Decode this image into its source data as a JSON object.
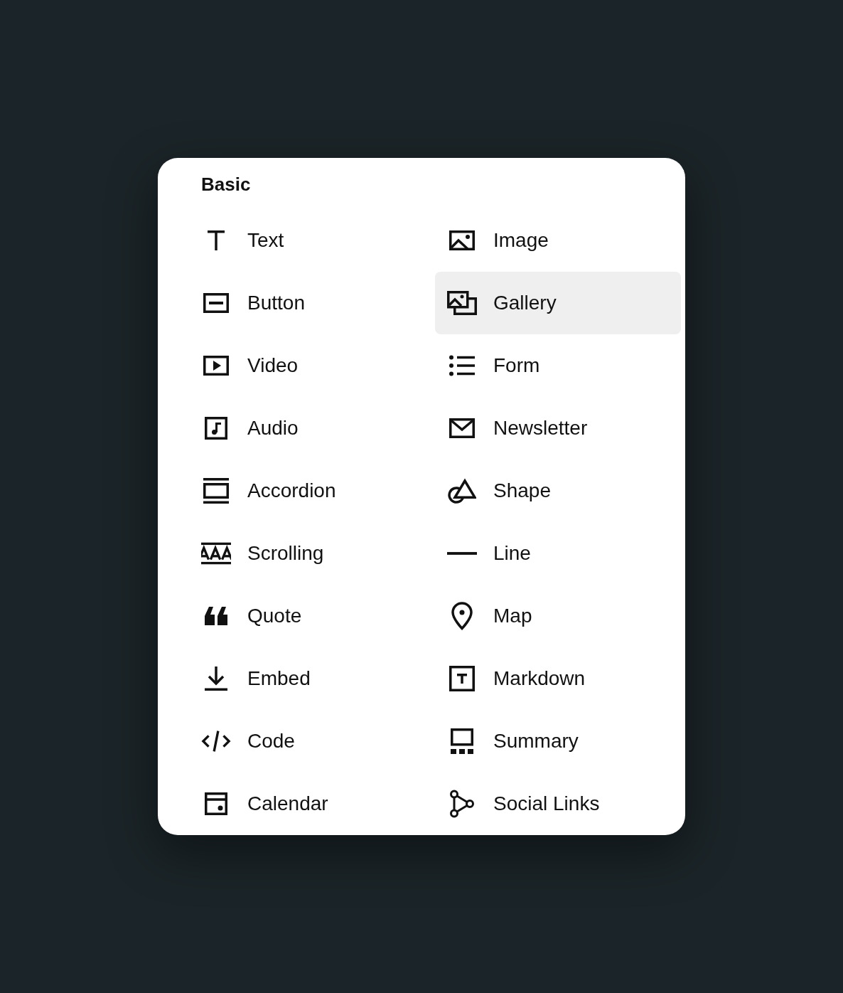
{
  "panel": {
    "heading": "Basic",
    "items": [
      {
        "label": "Text",
        "selected": false
      },
      {
        "label": "Image",
        "selected": false
      },
      {
        "label": "Button",
        "selected": false
      },
      {
        "label": "Gallery",
        "selected": true
      },
      {
        "label": "Video",
        "selected": false
      },
      {
        "label": "Form",
        "selected": false
      },
      {
        "label": "Audio",
        "selected": false
      },
      {
        "label": "Newsletter",
        "selected": false
      },
      {
        "label": "Accordion",
        "selected": false
      },
      {
        "label": "Shape",
        "selected": false
      },
      {
        "label": "Scrolling",
        "selected": false
      },
      {
        "label": "Line",
        "selected": false
      },
      {
        "label": "Quote",
        "selected": false
      },
      {
        "label": "Map",
        "selected": false
      },
      {
        "label": "Embed",
        "selected": false
      },
      {
        "label": "Markdown",
        "selected": false
      },
      {
        "label": "Code",
        "selected": false
      },
      {
        "label": "Summary",
        "selected": false
      },
      {
        "label": "Calendar",
        "selected": false
      },
      {
        "label": "Social Links",
        "selected": false
      }
    ]
  }
}
